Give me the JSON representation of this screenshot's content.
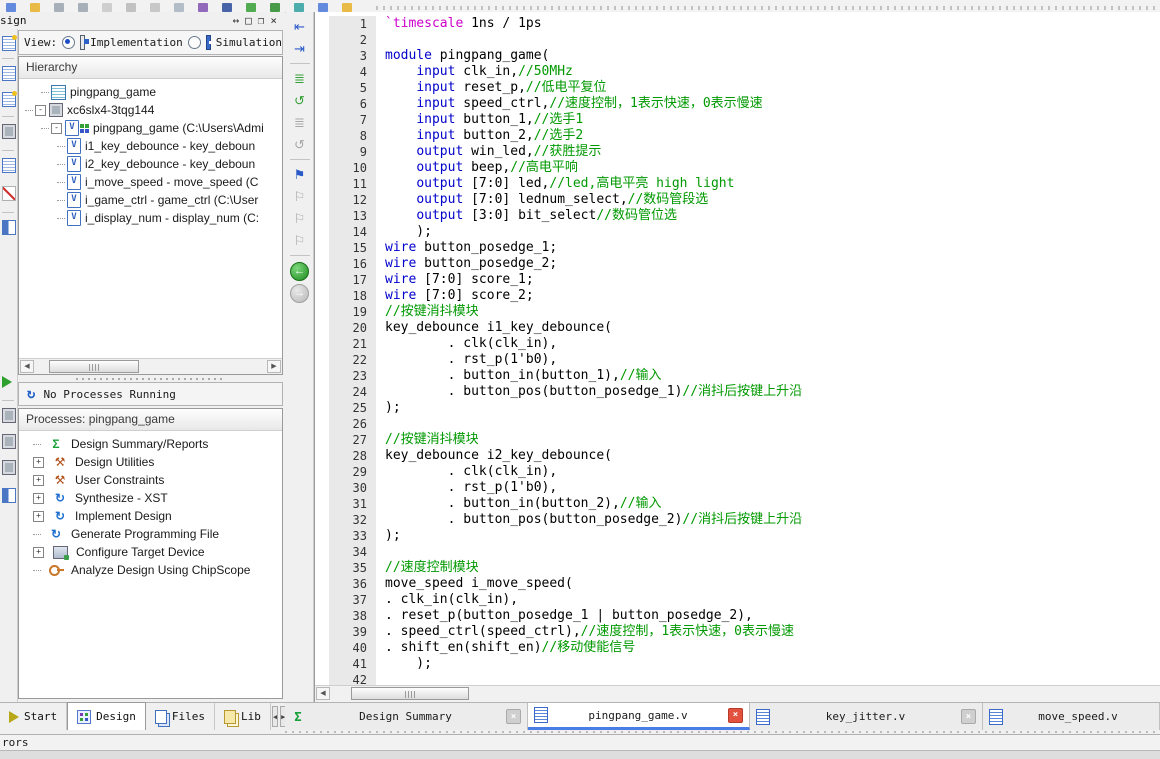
{
  "window": {
    "title_partial": "sign",
    "status_partial": "rors"
  },
  "glyphs": {
    "v_letter": "V",
    "sigma": "Σ",
    "tools": "⚒",
    "run": "↻",
    "refresh": "↻",
    "indent_left": "⇤",
    "indent_right": "⇥",
    "lines": "≣",
    "undo": "↺",
    "flag": "⚑",
    "flag_outline": "⚐",
    "back_arrow": "←",
    "fwd_arrow": "→",
    "left_small": "◀",
    "right_small": "▶",
    "close_x": "×",
    "resize": "↔",
    "maximize": "□",
    "restore": "❐"
  },
  "colors": {
    "keyword": "#0000cc",
    "preprocessor": "#cc00cc",
    "comment": "#009900",
    "text": "#000000",
    "active_tab_accent": "#4a7ce8"
  },
  "design_panel": {
    "view": {
      "label": "View:",
      "options": [
        {
          "label": "Implementation",
          "selected": true
        },
        {
          "label": "Simulation",
          "selected": false
        }
      ]
    },
    "hierarchy": {
      "header": "Hierarchy",
      "items": [
        {
          "label": "pingpang_game",
          "icon": "project",
          "level": 1,
          "expander": ""
        },
        {
          "label": "xc6slx4-3tqg144",
          "icon": "device-chip",
          "level": 0,
          "expander": "-"
        },
        {
          "label": "pingpang_game (C:\\Users\\Admi",
          "icon": "verilog-top",
          "level": 1,
          "expander": "-"
        },
        {
          "label": "i1_key_debounce - key_deboun",
          "icon": "verilog-file",
          "level": 2,
          "expander": ""
        },
        {
          "label": "i2_key_debounce - key_deboun",
          "icon": "verilog-file",
          "level": 2,
          "expander": ""
        },
        {
          "label": "i_move_speed - move_speed (C",
          "icon": "verilog-file",
          "level": 2,
          "expander": ""
        },
        {
          "label": "i_game_ctrl - game_ctrl (C:\\User",
          "icon": "verilog-file",
          "level": 2,
          "expander": ""
        },
        {
          "label": "i_display_num - display_num (C:",
          "icon": "verilog-file",
          "level": 2,
          "expander": ""
        }
      ]
    },
    "process_status": "No Processes Running",
    "processes": {
      "header": "Processes: pingpang_game",
      "items": [
        {
          "label": "Design Summary/Reports",
          "icon": "sigma",
          "expander": ""
        },
        {
          "label": "Design Utilities",
          "icon": "tools",
          "expander": "+"
        },
        {
          "label": "User Constraints",
          "icon": "tools",
          "expander": "+"
        },
        {
          "label": "Synthesize - XST",
          "icon": "run",
          "expander": "+"
        },
        {
          "label": "Implement Design",
          "icon": "run",
          "expander": "+"
        },
        {
          "label": "Generate Programming File",
          "icon": "run",
          "expander": ""
        },
        {
          "label": "Configure Target Device",
          "icon": "device",
          "expander": "+"
        },
        {
          "label": "Analyze Design Using ChipScope",
          "icon": "key",
          "expander": ""
        }
      ]
    },
    "tabs": [
      {
        "label": "Start",
        "icon": "start",
        "active": false
      },
      {
        "label": "Design",
        "icon": "design",
        "active": true
      },
      {
        "label": "Files",
        "icon": "files",
        "active": false
      },
      {
        "label": "Lib",
        "icon": "libraries",
        "active": false
      }
    ]
  },
  "editor": {
    "tabs": [
      {
        "label": "Design Summary",
        "icon": "summary",
        "close": "gray",
        "active": false
      },
      {
        "label": "pingpang_game.v",
        "icon": "doc",
        "close": "red",
        "active": true
      },
      {
        "label": "key_jitter.v",
        "icon": "doc",
        "close": "gray",
        "active": false
      },
      {
        "label": "move_speed.v",
        "icon": "doc",
        "close": "",
        "active": false
      }
    ],
    "code_lines": [
      [
        [
          "pre",
          "`timescale"
        ],
        [
          "txt",
          " 1ns / 1ps"
        ]
      ],
      [],
      [
        [
          "kw",
          "module"
        ],
        [
          "txt",
          " pingpang_game("
        ]
      ],
      [
        [
          "txt",
          "    "
        ],
        [
          "kw",
          "input"
        ],
        [
          "txt",
          " clk_in,"
        ],
        [
          "cmt",
          "//50MHz"
        ]
      ],
      [
        [
          "txt",
          "    "
        ],
        [
          "kw",
          "input"
        ],
        [
          "txt",
          " reset_p,"
        ],
        [
          "cmt",
          "//低电平复位"
        ]
      ],
      [
        [
          "txt",
          "    "
        ],
        [
          "kw",
          "input"
        ],
        [
          "txt",
          " speed_ctrl,"
        ],
        [
          "cmt",
          "//速度控制，1表示快速，0表示慢速"
        ]
      ],
      [
        [
          "txt",
          "    "
        ],
        [
          "kw",
          "input"
        ],
        [
          "txt",
          " button_1,"
        ],
        [
          "cmt",
          "//选手1"
        ]
      ],
      [
        [
          "txt",
          "    "
        ],
        [
          "kw",
          "input"
        ],
        [
          "txt",
          " button_2,"
        ],
        [
          "cmt",
          "//选手2"
        ]
      ],
      [
        [
          "txt",
          "    "
        ],
        [
          "kw",
          "output"
        ],
        [
          "txt",
          " win_led,"
        ],
        [
          "cmt",
          "//获胜提示"
        ]
      ],
      [
        [
          "txt",
          "    "
        ],
        [
          "kw",
          "output"
        ],
        [
          "txt",
          " beep,"
        ],
        [
          "cmt",
          "//高电平响"
        ]
      ],
      [
        [
          "txt",
          "    "
        ],
        [
          "kw",
          "output"
        ],
        [
          "txt",
          " [7:0] led,"
        ],
        [
          "cmt",
          "//led,高电平亮 high light"
        ]
      ],
      [
        [
          "txt",
          "    "
        ],
        [
          "kw",
          "output"
        ],
        [
          "txt",
          " [7:0] lednum_select,"
        ],
        [
          "cmt",
          "//数码管段选"
        ]
      ],
      [
        [
          "txt",
          "    "
        ],
        [
          "kw",
          "output"
        ],
        [
          "txt",
          " [3:0] bit_select"
        ],
        [
          "cmt",
          "//数码管位选"
        ]
      ],
      [
        [
          "txt",
          "    );"
        ]
      ],
      [
        [
          "kw",
          "wire"
        ],
        [
          "txt",
          " button_posedge_1;"
        ]
      ],
      [
        [
          "kw",
          "wire"
        ],
        [
          "txt",
          " button_posedge_2;"
        ]
      ],
      [
        [
          "kw",
          "wire"
        ],
        [
          "txt",
          " [7:0] score_1;"
        ]
      ],
      [
        [
          "kw",
          "wire"
        ],
        [
          "txt",
          " [7:0] score_2;"
        ]
      ],
      [
        [
          "cmt",
          "//按键消抖模块"
        ]
      ],
      [
        [
          "txt",
          "key_debounce i1_key_debounce("
        ]
      ],
      [
        [
          "txt",
          "        . clk(clk_in),"
        ]
      ],
      [
        [
          "txt",
          "        . rst_p(1'b0),"
        ]
      ],
      [
        [
          "txt",
          "        . button_in(button_1),"
        ],
        [
          "cmt",
          "//输入"
        ]
      ],
      [
        [
          "txt",
          "        . button_pos(button_posedge_1)"
        ],
        [
          "cmt",
          "//消抖后按键上升沿"
        ]
      ],
      [
        [
          "txt",
          ");"
        ]
      ],
      [],
      [
        [
          "cmt",
          "//按键消抖模块"
        ]
      ],
      [
        [
          "txt",
          "key_debounce i2_key_debounce("
        ]
      ],
      [
        [
          "txt",
          "        . clk(clk_in),"
        ]
      ],
      [
        [
          "txt",
          "        . rst_p(1'b0),"
        ]
      ],
      [
        [
          "txt",
          "        . button_in(button_2),"
        ],
        [
          "cmt",
          "//输入"
        ]
      ],
      [
        [
          "txt",
          "        . button_pos(button_posedge_2)"
        ],
        [
          "cmt",
          "//消抖后按键上升沿"
        ]
      ],
      [
        [
          "txt",
          ");"
        ]
      ],
      [],
      [
        [
          "cmt",
          "//速度控制模块"
        ]
      ],
      [
        [
          "txt",
          "move_speed i_move_speed("
        ]
      ],
      [
        [
          "txt",
          ". clk_in(clk_in),"
        ]
      ],
      [
        [
          "txt",
          ". reset_p(button_posedge_1 | button_posedge_2),"
        ]
      ],
      [
        [
          "txt",
          ". speed_ctrl(speed_ctrl),"
        ],
        [
          "cmt",
          "//速度控制，1表示快速，0表示慢速"
        ]
      ],
      [
        [
          "txt",
          ". shift_en(shift_en)"
        ],
        [
          "cmt",
          "//移动使能信号"
        ]
      ],
      [
        [
          "txt",
          "    );"
        ]
      ],
      []
    ]
  }
}
